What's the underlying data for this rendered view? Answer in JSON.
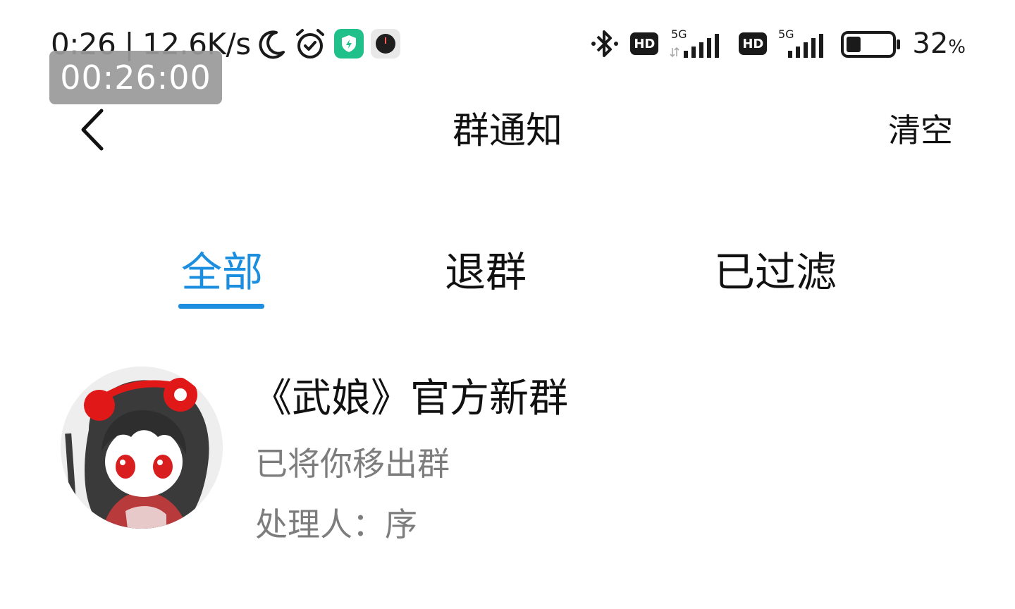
{
  "status_bar": {
    "time": "0:26",
    "separator": "|",
    "net_speed": "12.6K/s",
    "left_icons": [
      "moon-icon",
      "alarm-icon",
      "shield-app-icon",
      "clock-app-icon"
    ],
    "timer_overlay": "00:26:00",
    "right_icons": [
      "bluetooth-icon",
      "hd-icon",
      "signal-5g-icon",
      "hd-icon",
      "signal-5g-icon",
      "battery-icon"
    ],
    "hd_label": "HD",
    "net_type": "5G",
    "battery_level": 0.32,
    "battery_value": "32",
    "battery_unit": "%"
  },
  "header": {
    "title": "群通知",
    "clear_label": "清空",
    "back_icon": "chevron-left-icon"
  },
  "tabs": [
    {
      "label": "全部",
      "active": true
    },
    {
      "label": "退群",
      "active": false
    },
    {
      "label": "已过滤",
      "active": false
    }
  ],
  "colors": {
    "accent": "#1b8ee0",
    "secondary_text": "#7d7d7d",
    "shield_green": "#20c08a"
  },
  "notifications": [
    {
      "group_name": "《武娘》官方新群",
      "message": "已将你移出群",
      "handler": "处理人：序"
    }
  ]
}
